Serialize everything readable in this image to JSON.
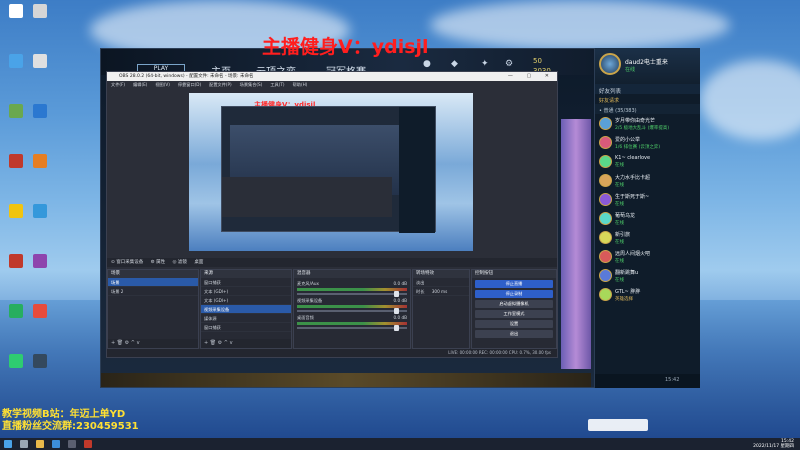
{
  "overlay": {
    "top_banner": "主播健身V：ydisjl",
    "bottom_line1": "教学视频B站：年迈上单YD",
    "bottom_line2": "直播粉丝交流群:230459531",
    "preview_banner": "主播健身V：ydisjl"
  },
  "desktop_icons": [
    {
      "label": "",
      "color": "#ffffff"
    },
    {
      "label": "",
      "color": "#d6d6d6"
    },
    {
      "label": "",
      "color": "#4aa3e8"
    },
    {
      "label": "",
      "color": "#e0e0e0"
    },
    {
      "label": "",
      "color": "#6aa84f"
    },
    {
      "label": "",
      "color": "#2b78d0"
    },
    {
      "label": "",
      "color": "#c0392b"
    },
    {
      "label": "",
      "color": "#e67e22"
    },
    {
      "label": "",
      "color": "#f1c40f"
    },
    {
      "label": "",
      "color": "#3498db"
    },
    {
      "label": "",
      "color": "#c0392b"
    },
    {
      "label": "",
      "color": "#8e44ad"
    },
    {
      "label": "",
      "color": "#27ae60"
    },
    {
      "label": "",
      "color": "#e74c3c"
    },
    {
      "label": "",
      "color": "#2ecc71"
    },
    {
      "label": "",
      "color": "#34495e"
    }
  ],
  "launcher": {
    "play_label": "PLAY",
    "nav_items": [
      "主页",
      "云顶之弈",
      "冠军格赛"
    ],
    "currency_1": "50",
    "currency_2": "3030"
  },
  "friends": {
    "user_name": "daud2电士重来",
    "user_status": "在线",
    "list_title": "好友列表",
    "requests": "好友请求",
    "group": "• 普通 (35/383)",
    "items": [
      {
        "name": "岁月带你由奇光芒",
        "status": "2/5 极地大乱斗 (爆率提高)",
        "color": "#5aa0d8"
      },
      {
        "name": "爱的小公举",
        "status": "1/6 排位赛 (云顶之弈)",
        "color": "#d85a7a"
      },
      {
        "name": "K1~ clearlove",
        "status": "在线",
        "color": "#5ad88a"
      },
      {
        "name": "大力水手比卡超",
        "status": "在线",
        "color": "#d8a55a"
      },
      {
        "name": "生于斯死于斯~",
        "status": "在线",
        "color": "#8a5ad8"
      },
      {
        "name": "葡萄乌龙",
        "status": "在线",
        "color": "#5ad8c8"
      },
      {
        "name": "新引旅",
        "status": "在线",
        "color": "#d8d85a"
      },
      {
        "name": "远周人间烟火吧",
        "status": "在线",
        "color": "#d85a5a"
      },
      {
        "name": "翻新跳舞u",
        "status": "在线",
        "color": "#5a7ad8"
      },
      {
        "name": "GTL~ 胖胖",
        "status": "英雄选择",
        "color": "#a8d85a"
      }
    ],
    "footer_time": "15:42"
  },
  "obs": {
    "title": "OBS 28.0.2 (64-bit, windows) - 配置文件: 未命名 - 场景: 未命名",
    "menu": [
      "文件(F)",
      "编辑(E)",
      "视图(V)",
      "停靠窗口(D)",
      "配置文件(P)",
      "场景集合(S)",
      "工具(T)",
      "帮助(H)"
    ],
    "toolbar": [
      "⊙ 窗口采集设备",
      "⚙ 属性",
      "◎ 滤镜",
      "桌面"
    ],
    "scenes": {
      "title": "场景",
      "items": [
        "场景",
        "场景 2"
      ]
    },
    "sources": {
      "title": "来源",
      "items": [
        "窗口捕获",
        "文本 (GDI+)",
        "文本 (GDI+)",
        "视频采集设备",
        "媒体源",
        "窗口捕获"
      ]
    },
    "mixer": {
      "title": "混音器",
      "tracks": [
        {
          "name": "麦克风/Aux",
          "db": "0.0 dB"
        },
        {
          "name": "视频采集设备",
          "db": "0.0 dB"
        },
        {
          "name": "桌面音频",
          "db": "0.0 dB"
        }
      ]
    },
    "transitions": {
      "title": "转场特效",
      "type": "淡出",
      "duration_label": "时长",
      "duration": "300 ms"
    },
    "controls": {
      "title": "控制按钮",
      "buttons": [
        "停止直播",
        "停止录制",
        "启动虚拟摄像机",
        "工作室模式",
        "设置",
        "退出"
      ]
    },
    "status": "LIVE: 00:00:00   REC: 00:00:00   CPU: 0.7%, 30.00 fps"
  },
  "taskbar": {
    "time": "15:42",
    "date": "2022/11/17 星期四"
  }
}
